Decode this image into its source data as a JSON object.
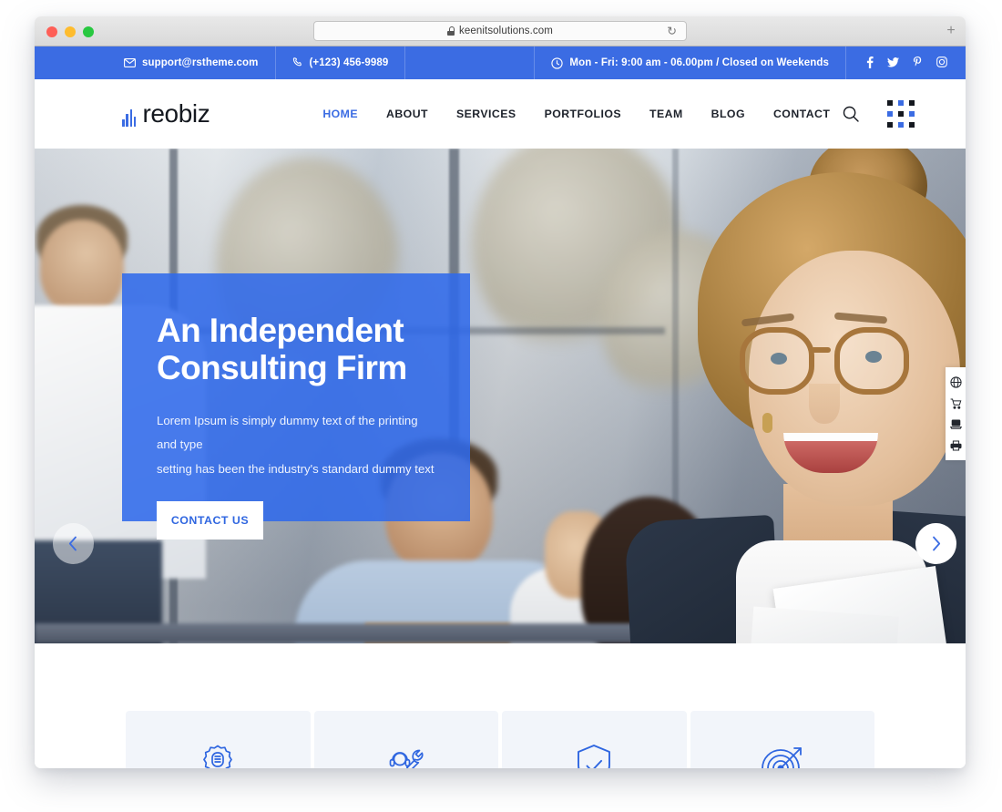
{
  "browser": {
    "url": "keenitsolutions.com",
    "lock_icon": "lock-icon",
    "reload_icon": "reload-icon",
    "new_tab_label": "+",
    "traffic_lights": [
      "close",
      "minimize",
      "maximize"
    ]
  },
  "topbar": {
    "email": "support@rstheme.com",
    "phone": "(+123) 456-9989",
    "hours": "Mon - Fri: 9:00 am - 06.00pm / Closed on Weekends",
    "email_icon": "envelope-icon",
    "phone_icon": "phone-icon",
    "clock_icon": "clock-icon",
    "social": [
      {
        "name": "facebook-icon",
        "label": "f"
      },
      {
        "name": "twitter-icon",
        "label": "t"
      },
      {
        "name": "pinterest-icon",
        "label": "p"
      },
      {
        "name": "instagram-icon",
        "label": "i"
      }
    ],
    "bg_color": "#3b6ce3"
  },
  "header": {
    "logo_text": "reobiz",
    "logo_icon": "bar-chart-logo-icon",
    "nav": [
      {
        "label": "HOME",
        "active": true
      },
      {
        "label": "ABOUT",
        "active": false
      },
      {
        "label": "SERVICES",
        "active": false
      },
      {
        "label": "PORTFOLIOS",
        "active": false
      },
      {
        "label": "TEAM",
        "active": false
      },
      {
        "label": "BLOG",
        "active": false
      },
      {
        "label": "CONTACT",
        "active": false
      }
    ],
    "search_icon": "search-icon",
    "grid_icon": "grid-menu-icon",
    "accent_color": "#3b6ce3"
  },
  "hero": {
    "title_line1": "An Independent",
    "title_line2": "Consulting Firm",
    "subtitle_line1": "Lorem Ipsum is simply dummy text of the printing and type",
    "subtitle_line2": "setting has been the industry's standard dummy text",
    "cta_label": "CONTACT US",
    "card_bg": "#306aea",
    "prev_icon": "chevron-left-icon",
    "next_icon": "chevron-right-icon"
  },
  "dock": {
    "items": [
      {
        "name": "globe-icon"
      },
      {
        "name": "shopping-cart-icon"
      },
      {
        "name": "laptop-icon"
      },
      {
        "name": "printer-icon"
      }
    ]
  },
  "services": {
    "cards": [
      {
        "icon": "gear-document-icon"
      },
      {
        "icon": "support-agent-wrench-icon"
      },
      {
        "icon": "shield-check-icon"
      },
      {
        "icon": "target-arrow-icon"
      }
    ],
    "card_bg": "#f2f5fa",
    "icon_color": "#2f66e0"
  }
}
